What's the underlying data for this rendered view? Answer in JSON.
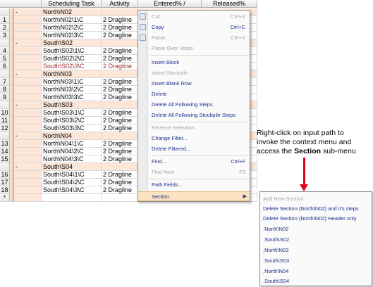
{
  "grid": {
    "columns": [
      "Scheduling Task",
      "Activity",
      "Entered% /",
      "Released%"
    ],
    "rows": [
      {
        "kind": "group",
        "num": "",
        "mark": "-",
        "task": "North\\N02",
        "activity": ""
      },
      {
        "kind": "detail",
        "num": "1",
        "mark": "",
        "task": "North\\N02\\1\\C",
        "activity": "2 Dragline"
      },
      {
        "kind": "detail",
        "num": "2",
        "mark": "",
        "task": "North\\N02\\2\\C",
        "activity": "2 Dragline"
      },
      {
        "kind": "detail",
        "num": "3",
        "mark": "",
        "task": "North\\N02\\3\\C",
        "activity": "2 Dragline"
      },
      {
        "kind": "group",
        "num": "",
        "mark": "-",
        "task": "South\\S02",
        "activity": ""
      },
      {
        "kind": "detail",
        "num": "4",
        "mark": "",
        "task": "South\\S02\\1\\C",
        "activity": "2 Dragline"
      },
      {
        "kind": "detail",
        "num": "5",
        "mark": "",
        "task": "South\\S02\\2\\C",
        "activity": "2 Dragline"
      },
      {
        "kind": "detail",
        "num": "6",
        "mark": "",
        "task": "South\\S02\\3\\C",
        "activity": "2 Dragline",
        "red": true
      },
      {
        "kind": "group",
        "num": "",
        "mark": "-",
        "task": "North\\N03",
        "activity": ""
      },
      {
        "kind": "detail",
        "num": "7",
        "mark": "",
        "task": "North\\N03\\1\\C",
        "activity": "2 Dragline"
      },
      {
        "kind": "detail",
        "num": "8",
        "mark": "",
        "task": "North\\N03\\2\\C",
        "activity": "2 Dragline"
      },
      {
        "kind": "detail",
        "num": "9",
        "mark": "",
        "task": "North\\N03\\3\\C",
        "activity": "2 Dragline"
      },
      {
        "kind": "group",
        "num": "",
        "mark": "-",
        "task": "South\\S03",
        "activity": ""
      },
      {
        "kind": "detail",
        "num": "10",
        "mark": "",
        "task": "South\\S03\\1\\C",
        "activity": "2 Dragline"
      },
      {
        "kind": "detail",
        "num": "11",
        "mark": "",
        "task": "South\\S03\\2\\C",
        "activity": "2 Dragline"
      },
      {
        "kind": "detail",
        "num": "12",
        "mark": "",
        "task": "South\\S03\\3\\C",
        "activity": "2 Dragline"
      },
      {
        "kind": "group",
        "num": "",
        "mark": "-",
        "task": "North\\N04",
        "activity": ""
      },
      {
        "kind": "detail",
        "num": "13",
        "mark": "",
        "task": "North\\N04\\1\\C",
        "activity": "2 Dragline"
      },
      {
        "kind": "detail",
        "num": "14",
        "mark": "",
        "task": "North\\N04\\2\\C",
        "activity": "2 Dragline"
      },
      {
        "kind": "detail",
        "num": "15",
        "mark": "",
        "task": "North\\N04\\3\\C",
        "activity": "2 Dragline"
      },
      {
        "kind": "group",
        "num": "",
        "mark": "-",
        "task": "South\\S04",
        "activity": ""
      },
      {
        "kind": "detail",
        "num": "16",
        "mark": "",
        "task": "South\\S04\\1\\C",
        "activity": "2 Dragline"
      },
      {
        "kind": "detail",
        "num": "17",
        "mark": "",
        "task": "South\\S04\\2\\C",
        "activity": "2 Dragline"
      },
      {
        "kind": "detail",
        "num": "18",
        "mark": "",
        "task": "South\\S04\\3\\C",
        "activity": "2 Dragline"
      },
      {
        "kind": "new",
        "num": "*",
        "mark": "",
        "task": "",
        "activity": ""
      }
    ]
  },
  "context_menu": {
    "cut": {
      "label": "Cut",
      "shortcut": "Ctrl+X"
    },
    "copy": {
      "label": "Copy",
      "shortcut": "Ctrl+C"
    },
    "paste": {
      "label": "Paste",
      "shortcut": "Ctrl+V"
    },
    "paste_over": {
      "label": "Paste Over Steps"
    },
    "insert_block": {
      "label": "Insert Block"
    },
    "insert_stockpile": {
      "label": "Insert Stockpile"
    },
    "insert_blank_row": {
      "label": "Insert Blank Row"
    },
    "delete": {
      "label": "Delete"
    },
    "delete_following_steps": {
      "label": "Delete All Following Steps"
    },
    "delete_following_stockpile": {
      "label": "Delete All Following Stockpile Steps"
    },
    "reverse_selection": {
      "label": "Reverse Selection"
    },
    "change_filter": {
      "label": "Change Filter..."
    },
    "delete_filtered": {
      "label": "Delete Filtered..."
    },
    "find": {
      "label": "Find...",
      "shortcut": "Ctrl+F"
    },
    "find_next": {
      "label": "Find Next",
      "shortcut": "F3"
    },
    "path_fields": {
      "label": "Path Fields..."
    },
    "section": {
      "label": "Section",
      "arrow": "▶"
    }
  },
  "section_submenu": {
    "items": [
      "Add New Section",
      "Delete Section (North\\N02) and it's steps",
      "Delete Section (North\\N02) Header only",
      ".North\\N02",
      ".South\\S02",
      ".North\\N03",
      ".South\\S03",
      ".North\\N04",
      ".South\\S04"
    ]
  },
  "callout": {
    "line1": "Right-click on input path to",
    "line2": "invoke the context menu and",
    "line3_pre": "access the ",
    "line3_bold": "Section",
    "line3_post": " sub-menu"
  },
  "colors": {
    "arrow": "#e3001b",
    "menu_text": "#1b2f8a",
    "group_bg": "#fce6d8",
    "highlight": "#fbe2c0"
  }
}
